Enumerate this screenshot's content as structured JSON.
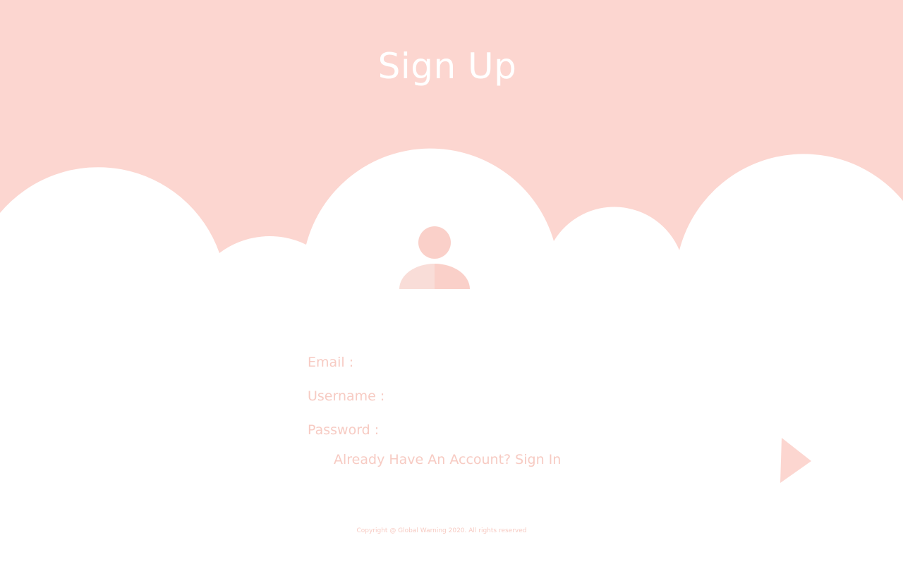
{
  "header": {
    "title": "Sign Up"
  },
  "form": {
    "email_label": "Email :",
    "username_label": "Username :",
    "password_label": "Password :",
    "email_value": "",
    "username_value": "",
    "password_value": "",
    "signin_link": "Already Have An Account? Sign In",
    "submit_icon": "play-triangle-icon"
  },
  "footer": {
    "copyright": "Copyright @ Global Warning 2020. All rights reserved"
  },
  "colors": {
    "accent_pink": "#fcd6d0",
    "text_pink": "#f7cbc3",
    "avatar_light": "#f9ddd8",
    "background": "#ffffff",
    "title": "#ffffff"
  },
  "icons": {
    "avatar": "user-avatar-icon",
    "submit": "play-triangle-icon"
  }
}
